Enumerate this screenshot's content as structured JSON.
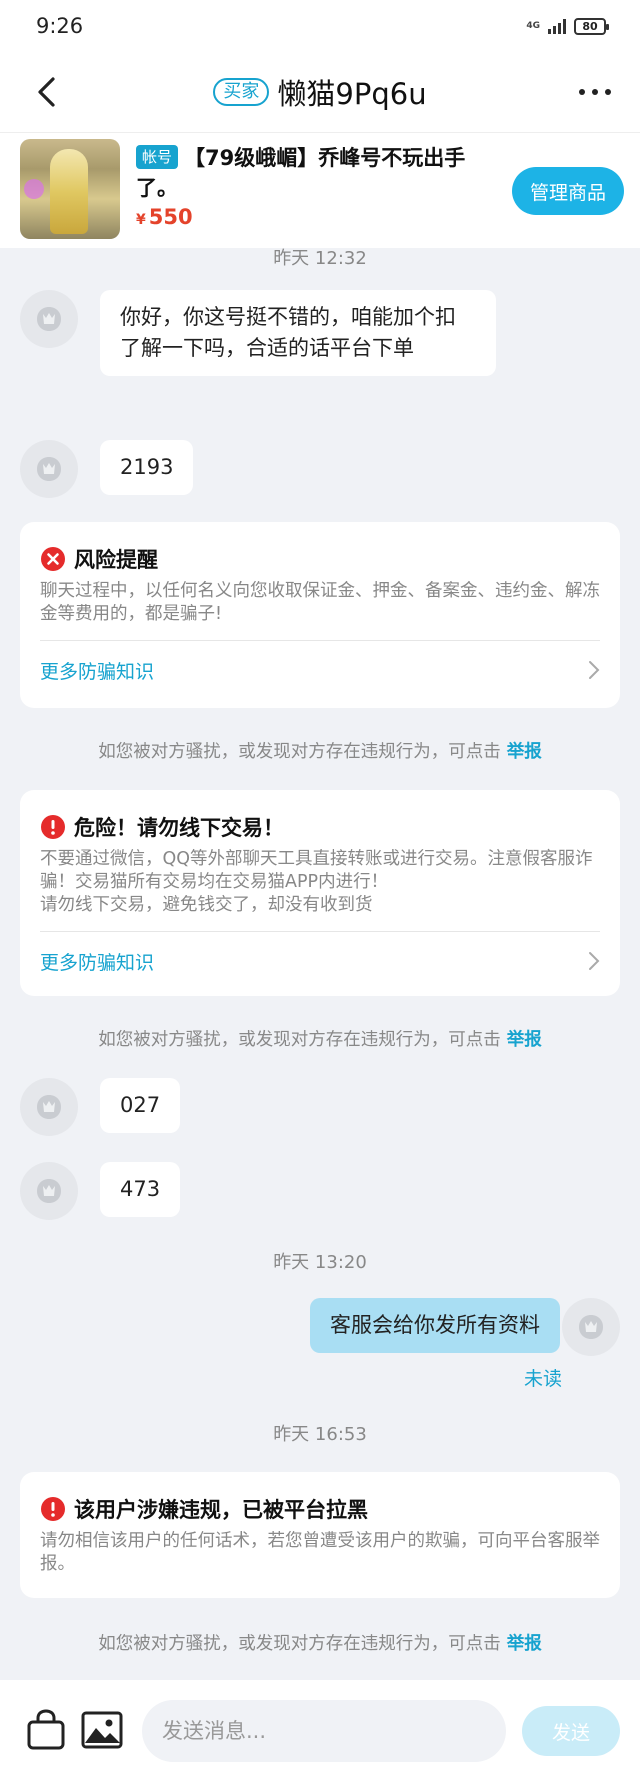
{
  "status_bar": {
    "time": "9:26",
    "network": "4G",
    "battery": "80"
  },
  "header": {
    "role_tag": "买家",
    "title": "懒猫9Pq6u",
    "back_icon": "chevron-left-icon",
    "more_icon": "more-dots-icon"
  },
  "product": {
    "tag": "帐号",
    "title": "【79级峨嵋】乔峰号不玩出手了。",
    "currency": "¥",
    "price": "550",
    "manage_label": "管理商品"
  },
  "chat": {
    "time_1": "昨天  12:32",
    "msg_1": "你好，你这号挺不错的，咱能加个扣了解一下吗，合适的话平台下单",
    "msg_2": "2193",
    "risk_card": {
      "title": "风险提醒",
      "body": "聊天过程中，以任何名义向您收取保证金、押金、备案金、违约金、解冻金等费用的，都是骗子!",
      "link": "更多防骗知识"
    },
    "notice_text": "如您被对方骚扰，或发现对方存在违规行为，可点击",
    "report_label": "举报",
    "danger_card": {
      "title": "危险！请勿线下交易！",
      "body_1": "不要通过微信，QQ等外部聊天工具直接转账或进行交易。注意假客服诈骗！交易猫所有交易均在交易猫APP内进行！",
      "body_2": "请勿线下交易，避免钱交了，却没有收到货",
      "link": "更多防骗知识"
    },
    "msg_3": "027",
    "msg_4": "473",
    "time_2": "昨天  13:20",
    "msg_5": "客服会给你发所有资料",
    "unread_label": "未读",
    "time_3": "昨天  16:53",
    "ban_card": {
      "title": "该用户涉嫌违规，已被平台拉黑",
      "body": "请勿相信该用户的任何话术，若您曾遭受该用户的欺骗，可向平台客服举报。"
    }
  },
  "bottom_bar": {
    "input_placeholder": "发送消息...",
    "send_label": "发送"
  },
  "colors": {
    "accent": "#17a3cf",
    "price": "#e4432b",
    "danger": "#e52b2b",
    "my_bubble": "#a9def3"
  }
}
